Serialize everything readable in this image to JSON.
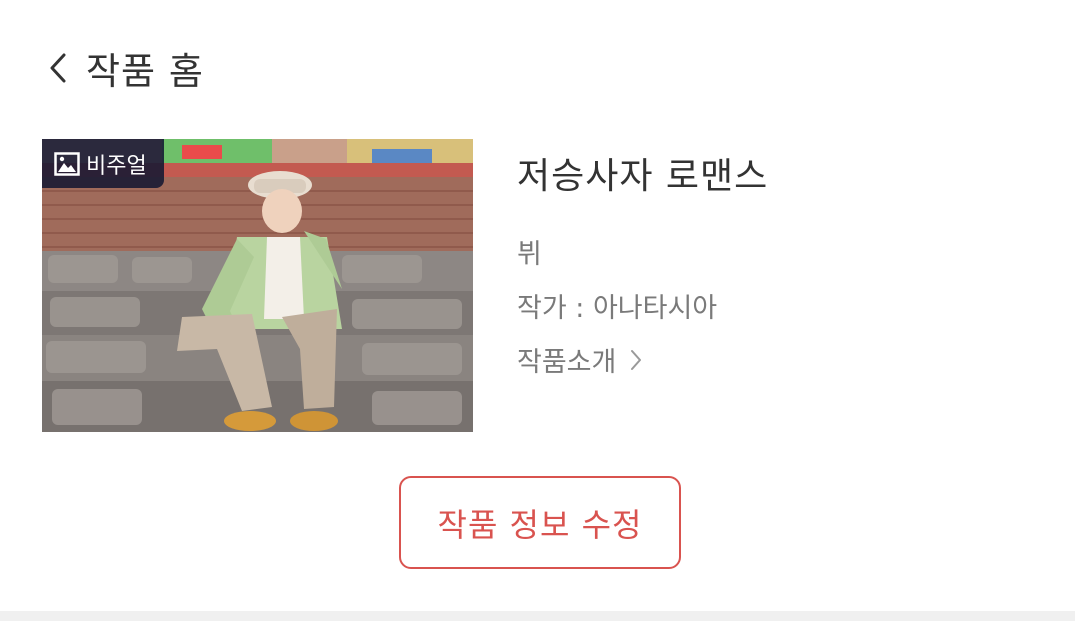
{
  "header": {
    "title": "작품 홈"
  },
  "work": {
    "badge_label": "비주얼",
    "title": "저승사자 로맨스",
    "character": "뷔",
    "author": "작가 : 아나타시아",
    "intro_label": "작품소개"
  },
  "actions": {
    "edit_label": "작품 정보 수정"
  }
}
